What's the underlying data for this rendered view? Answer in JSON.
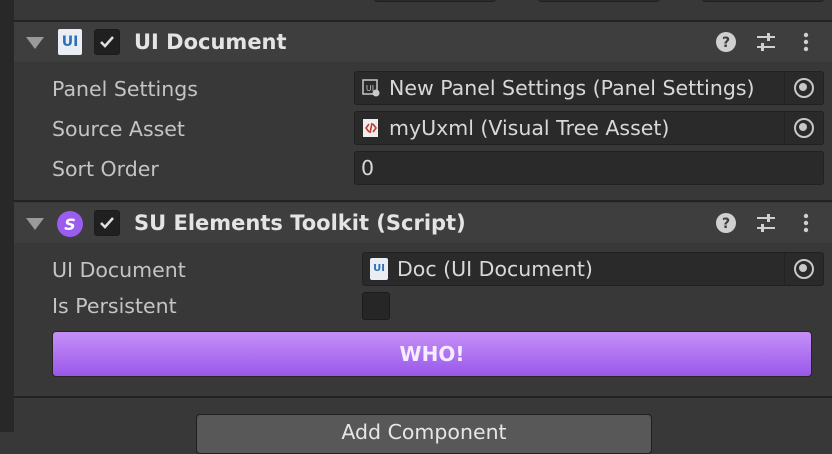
{
  "components": [
    {
      "title": "UI Document",
      "icon": "ui-document-icon",
      "enabled": true,
      "properties": [
        {
          "label": "Panel Settings",
          "value": "New Panel Settings (Panel Settings)",
          "icon": "panel-settings-icon"
        },
        {
          "label": "Source Asset",
          "value": "myUxml (Visual Tree Asset)",
          "icon": "uxml-asset-icon"
        },
        {
          "label": "Sort Order",
          "value": "0"
        }
      ]
    },
    {
      "title": "SU Elements Toolkit (Script)",
      "icon": "script-icon",
      "enabled": true,
      "properties": [
        {
          "label": "UI Document",
          "value": "Doc (UI Document)",
          "icon": "ui-document-icon"
        },
        {
          "label": "Is Persistent",
          "checked": false
        }
      ],
      "button_label": "WHO!"
    }
  ],
  "add_component_label": "Add Component",
  "colors": {
    "accent_button_top": "#c591f7",
    "accent_button_bottom": "#9a57ea",
    "script_icon": "#9b5cf0"
  }
}
